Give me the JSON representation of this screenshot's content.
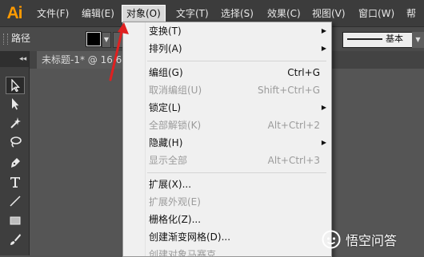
{
  "app": {
    "logo": "Ai"
  },
  "menubar": {
    "items": [
      "文件(F)",
      "编辑(E)",
      "对象(O)",
      "文字(T)",
      "选择(S)",
      "效果(C)",
      "视图(V)",
      "窗口(W)",
      "帮"
    ]
  },
  "controlbar": {
    "selection_label": "路径",
    "brush_label": "基本",
    "fill_color": "#000000"
  },
  "tools": {
    "icons": [
      "selection-tool-icon",
      "direct-selection-tool-icon",
      "magic-wand-icon",
      "lasso-icon",
      "pen-icon",
      "type-icon",
      "line-icon",
      "rectangle-icon",
      "paintbrush-icon"
    ]
  },
  "document": {
    "tab_title": "未标题-1* @ 16.6"
  },
  "object_menu": {
    "items": [
      {
        "label": "变换(T)",
        "shortcut": "",
        "submenu": true,
        "enabled": true
      },
      {
        "label": "排列(A)",
        "shortcut": "",
        "submenu": true,
        "enabled": true
      },
      {
        "label": "编组(G)",
        "shortcut": "Ctrl+G",
        "submenu": false,
        "enabled": true
      },
      {
        "label": "取消编组(U)",
        "shortcut": "Shift+Ctrl+G",
        "submenu": false,
        "enabled": false
      },
      {
        "label": "锁定(L)",
        "shortcut": "",
        "submenu": true,
        "enabled": true
      },
      {
        "label": "全部解锁(K)",
        "shortcut": "Alt+Ctrl+2",
        "submenu": false,
        "enabled": false
      },
      {
        "label": "隐藏(H)",
        "shortcut": "",
        "submenu": true,
        "enabled": true
      },
      {
        "label": "显示全部",
        "shortcut": "Alt+Ctrl+3",
        "submenu": false,
        "enabled": false
      },
      {
        "label": "扩展(X)...",
        "shortcut": "",
        "submenu": false,
        "enabled": true
      },
      {
        "label": "扩展外观(E)",
        "shortcut": "",
        "submenu": false,
        "enabled": false
      },
      {
        "label": "栅格化(Z)...",
        "shortcut": "",
        "submenu": false,
        "enabled": true
      },
      {
        "label": "创建渐变网格(D)...",
        "shortcut": "",
        "submenu": false,
        "enabled": true
      },
      {
        "label": "创建对象马赛克",
        "shortcut": "",
        "submenu": false,
        "enabled": false
      }
    ]
  },
  "watermark": {
    "text": "悟空问答"
  },
  "colors": {
    "accent_arrow": "#e02020",
    "logo": "#ff9a00"
  }
}
